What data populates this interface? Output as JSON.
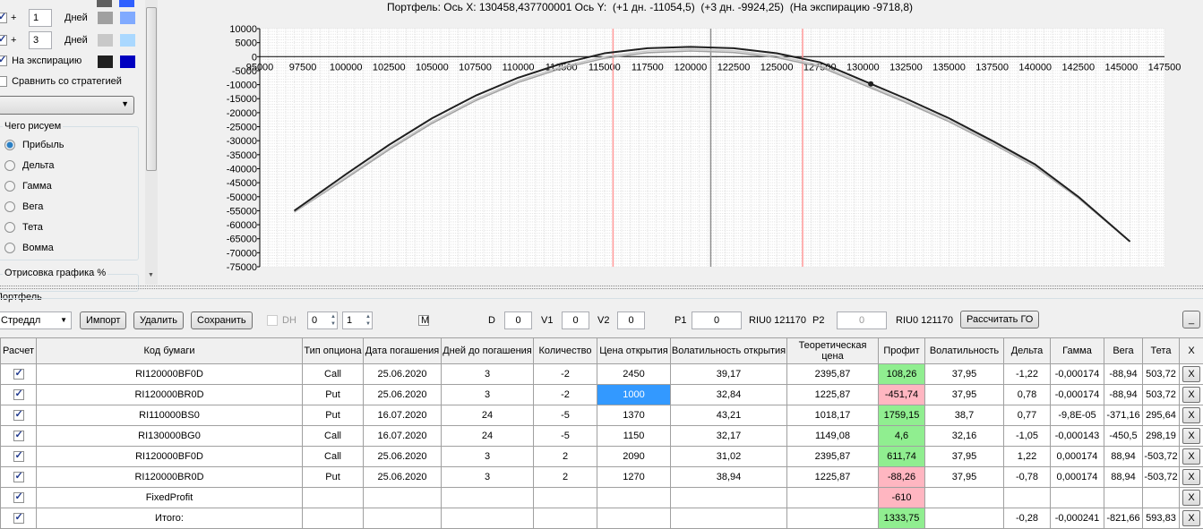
{
  "left_panel": {
    "rows": [
      {
        "checked": true,
        "plus": "+",
        "days": "1",
        "unit": "Дней",
        "color1": "#a0a0a0",
        "color2": "#80aaff"
      },
      {
        "checked": true,
        "plus": "+",
        "days": "3",
        "unit": "Дней",
        "color1": "#c8c8c8",
        "color2": "#aad8ff"
      }
    ],
    "expiration": {
      "checked": true,
      "label": "На экспирацию",
      "color1": "#202020",
      "color2": "#0000c0"
    },
    "compare": {
      "checked": false,
      "label": "Сравнить со стратегией"
    },
    "strategy_select": "",
    "draw_group": {
      "title": "Чего рисуем",
      "options": [
        "Прибыль",
        "Дельта",
        "Гамма",
        "Вега",
        "Тета",
        "Вомма"
      ],
      "selected": "Прибыль"
    },
    "render_group": {
      "title": "Отрисовка графика %"
    }
  },
  "chart_data": {
    "type": "line",
    "title": "Портфель: Ось X: 130458,437700001 Ось Y:  (+1 дн. -11054,5)  (+3 дн. -9924,25)  (На экспирацию -9718,8)",
    "xlim": [
      95000,
      147500
    ],
    "ylim": [
      -75000,
      10000
    ],
    "xticks": [
      95000,
      97500,
      100000,
      102500,
      105000,
      107500,
      110000,
      112500,
      115000,
      117500,
      120000,
      122500,
      125000,
      127500,
      130000,
      132500,
      135000,
      137500,
      140000,
      142500,
      145000,
      147500
    ],
    "yticks": [
      10000,
      5000,
      0,
      -5000,
      -10000,
      -15000,
      -20000,
      -25000,
      -30000,
      -35000,
      -40000,
      -45000,
      -50000,
      -55000,
      -60000,
      -65000,
      -70000,
      -75000
    ],
    "grid": true,
    "series": [
      {
        "name": "+1 дн.",
        "color": "#a0a0a0",
        "x": [
          97000,
          100000,
          102500,
          105000,
          107500,
          110000,
          112500,
          115000,
          117500,
          120000,
          122500,
          125000,
          127500,
          130000,
          132500,
          135000,
          137500,
          140000,
          142500,
          145500
        ],
        "y": [
          -55500,
          -43500,
          -33200,
          -23800,
          -15800,
          -9200,
          -4200,
          -600,
          1400,
          2000,
          1500,
          -300,
          -3600,
          -10000,
          -16400,
          -23200,
          -31000,
          -39400,
          -50500,
          -66000
        ]
      },
      {
        "name": "+3 дн.",
        "color": "#c8c8c8",
        "x": [
          97000,
          100000,
          102500,
          105000,
          107500,
          110000,
          112500,
          115000,
          117500,
          120000,
          122500,
          125000,
          127500,
          130000,
          132500,
          135000,
          137500,
          140000,
          142500,
          145500
        ],
        "y": [
          -55300,
          -43000,
          -32600,
          -23200,
          -15200,
          -8600,
          -3600,
          0,
          2000,
          2600,
          2100,
          300,
          -3000,
          -9400,
          -15900,
          -22800,
          -30600,
          -39100,
          -50300,
          -66000
        ]
      },
      {
        "name": "На экспирацию",
        "color": "#202020",
        "x": [
          97000,
          100000,
          102500,
          105000,
          107500,
          110000,
          112500,
          115000,
          117500,
          120000,
          122500,
          125000,
          127500,
          130000,
          132500,
          135000,
          137500,
          140000,
          142500,
          145500
        ],
        "y": [
          -55000,
          -42000,
          -31500,
          -22000,
          -14000,
          -7500,
          -2500,
          1200,
          3000,
          3500,
          3000,
          1200,
          -2000,
          -8500,
          -15000,
          -22000,
          -30000,
          -38500,
          -50000,
          -66000
        ]
      }
    ],
    "vlines": [
      {
        "x": 115500,
        "color": "#ff9999"
      },
      {
        "x": 126500,
        "color": "#ff9999"
      },
      {
        "x": 121170,
        "color": "#909090"
      }
    ],
    "marker": {
      "x": 130458,
      "y": -9718.8
    }
  },
  "portfolio": {
    "group_title": "Портфель",
    "strategy": "Стреддл",
    "import": "Импорт",
    "delete": "Удалить",
    "save": "Сохранить",
    "dh_label": "DH",
    "spin1": "0",
    "spin2": "1",
    "m_label": "M",
    "d_label": "D",
    "d_val": "0",
    "v1_label": "V1",
    "v1_val": "0",
    "v2_label": "V2",
    "v2_val": "0",
    "p1_label": "P1",
    "p1_val": "0",
    "p1_ticker": "RIU0 121170",
    "p2_label": "P2",
    "p2_val": "0",
    "p2_ticker": "RIU0 121170",
    "calc_go": "Рассчитать ГО",
    "minimize": "_"
  },
  "table": {
    "headers": [
      "Расчет",
      "Код бумаги",
      "Тип опциона",
      "Дата погашения",
      "Дней до погашения",
      "Количество",
      "Цена открытия",
      "Волатильность открытия",
      "Теоретическая цена",
      "Профит",
      "Волатильность",
      "Дельта",
      "Гамма",
      "Вега",
      "Тета",
      "X"
    ],
    "rows": [
      [
        "RI120000BF0D",
        "Call",
        "25.06.2020",
        "3",
        "-2",
        "2450",
        "39,17",
        "2395,87",
        "108,26",
        "37,95",
        "-1,22",
        "-0,000174",
        "-88,94",
        "503,72"
      ],
      [
        "RI120000BR0D",
        "Put",
        "25.06.2020",
        "3",
        "-2",
        "1000",
        "32,84",
        "1225,87",
        "-451,74",
        "37,95",
        "0,78",
        "-0,000174",
        "-88,94",
        "503,72"
      ],
      [
        "RI110000BS0",
        "Put",
        "16.07.2020",
        "24",
        "-5",
        "1370",
        "43,21",
        "1018,17",
        "1759,15",
        "38,7",
        "0,77",
        "-9,8E-05",
        "-371,16",
        "295,64"
      ],
      [
        "RI130000BG0",
        "Call",
        "16.07.2020",
        "24",
        "-5",
        "1150",
        "32,17",
        "1149,08",
        "4,6",
        "32,16",
        "-1,05",
        "-0,000143",
        "-450,5",
        "298,19"
      ],
      [
        "RI120000BF0D",
        "Call",
        "25.06.2020",
        "3",
        "2",
        "2090",
        "31,02",
        "2395,87",
        "611,74",
        "37,95",
        "1,22",
        "0,000174",
        "88,94",
        "-503,72"
      ],
      [
        "RI120000BR0D",
        "Put",
        "25.06.2020",
        "3",
        "2",
        "1270",
        "38,94",
        "1225,87",
        "-88,26",
        "37,95",
        "-0,78",
        "0,000174",
        "88,94",
        "-503,72"
      ],
      [
        "FixedProfit",
        "",
        "",
        "",
        "",
        "",
        "",
        "",
        "-610",
        "",
        "",
        "",
        "",
        ""
      ],
      [
        "Итого:",
        "",
        "",
        "",
        "",
        "",
        "",
        "",
        "1333,75",
        "",
        "-0,28",
        "-0,000241",
        "-821,66",
        "593,83"
      ]
    ],
    "delete_label": "X",
    "profit_colors": {
      "positive": "#90ee90",
      "negative": "#ffb6c1"
    }
  }
}
